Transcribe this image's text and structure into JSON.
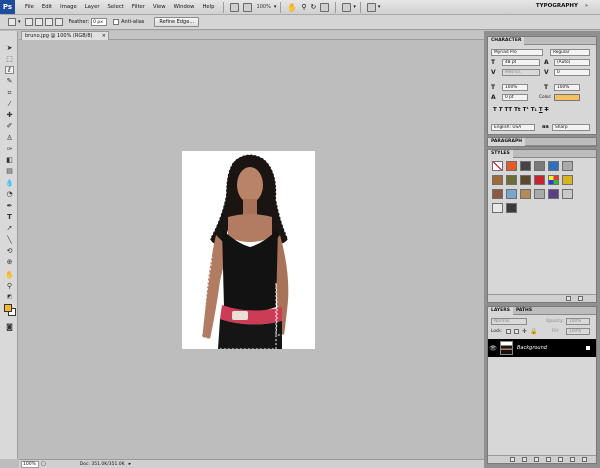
{
  "app": {
    "logo": "Ps",
    "workspace": "TYPOGRAPHY",
    "zoom_level": "100%"
  },
  "menu": [
    "File",
    "Edit",
    "Image",
    "Layer",
    "Select",
    "Filter",
    "View",
    "Window",
    "Help"
  ],
  "options_bar": {
    "feather_label": "Feather:",
    "feather_value": "0 px",
    "anti_alias_label": "Anti-alias",
    "refine_edge_label": "Refine Edge..."
  },
  "document": {
    "tab_title": "bruno.jpg @ 100% (RGB/8)",
    "close_glyph": "×"
  },
  "status": {
    "zoom": "100%",
    "doc": "Doc: 351.0K/351.0K"
  },
  "panels": {
    "character": {
      "tab": "CHARACTER",
      "font_family": "Myriad Pro",
      "font_style": "Regular",
      "size": "48 pt",
      "leading": "(Auto)",
      "kerning": "Metrics",
      "tracking": "0",
      "vscale": "100%",
      "hscale": "100%",
      "baseline": "0 pt",
      "color_label": "Color:",
      "language": "English: USA",
      "antialias": "Sharp"
    },
    "paragraph": {
      "tab": "PARAGRAPH"
    },
    "styles": {
      "tab": "STYLES"
    },
    "layers": {
      "tab": "LAYERS",
      "tab2": "PATHS",
      "blend_mode": "Normal",
      "opacity_label": "Opacity:",
      "opacity": "100%",
      "lock_label": "Lock:",
      "fill_label": "Fill:",
      "fill": "100%",
      "layer_name": "Background"
    }
  },
  "colors": {
    "foreground": "#f5b830",
    "background": "#ffffff",
    "text_color": "#f3c062"
  }
}
